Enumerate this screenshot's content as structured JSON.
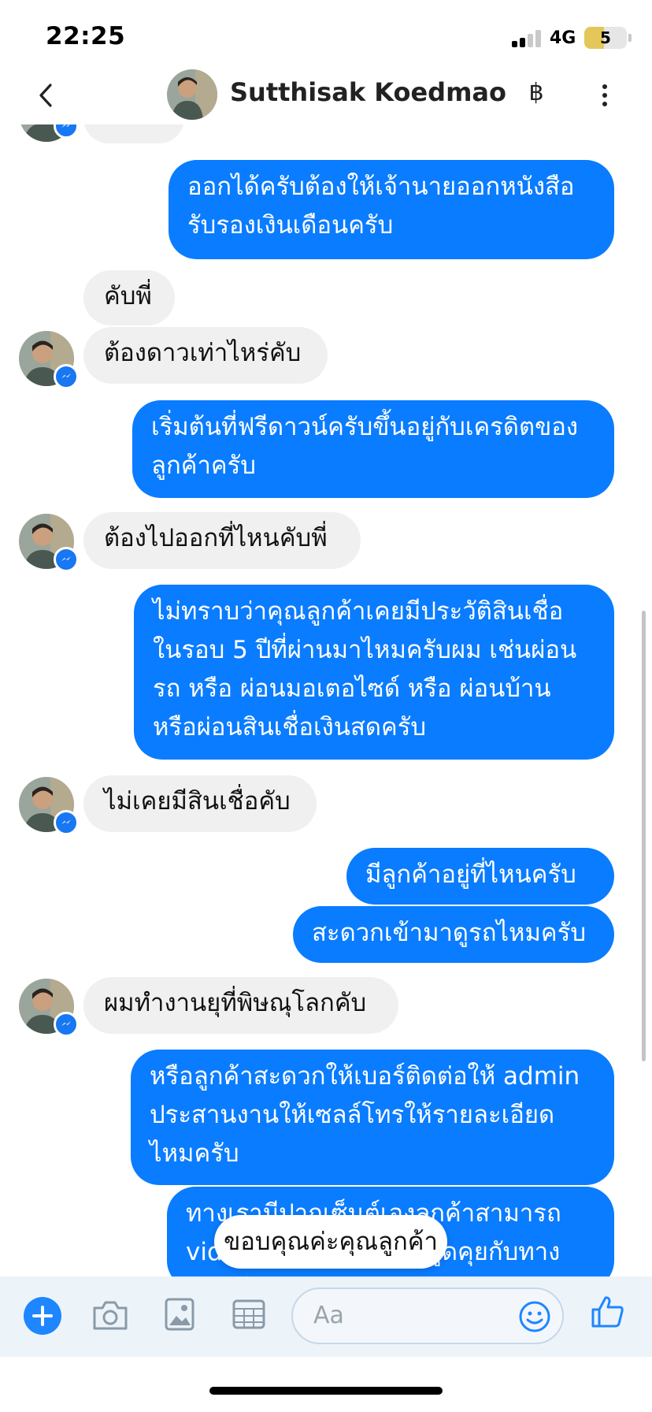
{
  "status_bar": {
    "time": "22:25",
    "network": "4G",
    "battery": "5"
  },
  "header": {
    "contact_name": "Sutthisak Koedmao",
    "currency_symbol": "฿"
  },
  "messages": [
    {
      "direction": "out",
      "text": "ออกได้ครับต้องให้เจ้านายออกหนังสือ\nรับรองเงินเดือนครับ"
    },
    {
      "direction": "in",
      "text": "คับพี่"
    },
    {
      "direction": "in",
      "text": "ต้องดาวเท่าไหร่คับ"
    },
    {
      "direction": "out",
      "text": "เริ่มต้นที่ฟรีดาวน์ครับขึ้นอยู่กับเครดิตของ\nลูกค้าครับ"
    },
    {
      "direction": "in",
      "text": "ต้องไปออกที่ไหนคับพี่"
    },
    {
      "direction": "out",
      "text": "ไม่ทราบว่าคุณลูกค้าเคยมีประวัติสินเชื่อ\nในรอบ 5 ปีที่ผ่านมาไหมครับผม เช่นผ่อน\nรถ หรือ ผ่อนมอเตอไซด์ หรือ ผ่อนบ้าน\nหรือผ่อนสินเชื่อเงินสดครับ"
    },
    {
      "direction": "in",
      "text": "ไม่เคยมีสินเชื่อคับ"
    },
    {
      "direction": "out",
      "text": "มีลูกค้าอยู่ที่ไหนครับ"
    },
    {
      "direction": "out",
      "text": "สะดวกเข้ามาดูรถไหมครับ"
    },
    {
      "direction": "in",
      "text": "ผมทำงานยุที่พิษณุโลกคับ"
    },
    {
      "direction": "out",
      "text": "หรือลูกค้าสะดวกให้เบอร์ติดต่อให้ admin\nประสานงานให้เซลล์โทรให้รายละเอียด\nไหมครับ"
    },
    {
      "direction": "out",
      "text": "ทางเรามีปากเซ็นต์เองลูกค้าสามารถ\nvideo call ให้ลูกค้าไปพูดคุยกับทางเซลล์ได้เลย"
    }
  ],
  "toast": {
    "text": "ขอบคุณค่ะคุณลูกค้า"
  },
  "composer": {
    "placeholder": "Aa"
  },
  "colors": {
    "outgoing_bubble": "#0a7cff",
    "incoming_bubble": "#f0f0f0",
    "accent": "#1e86ff"
  }
}
